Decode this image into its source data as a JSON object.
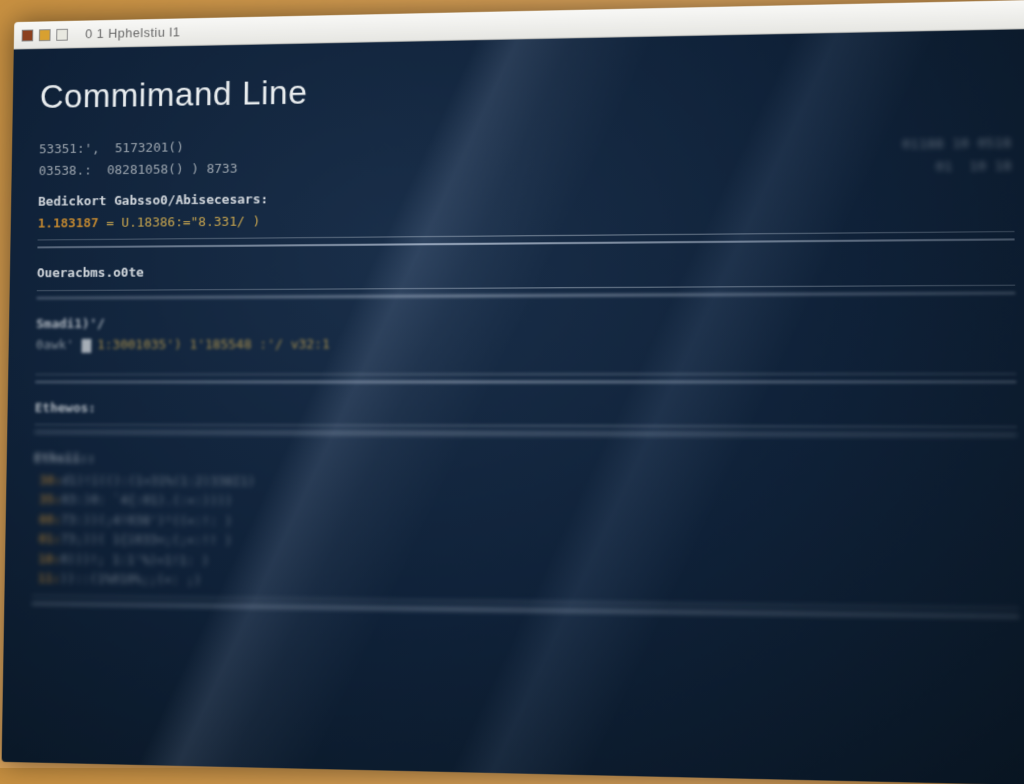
{
  "window": {
    "title": "0 1  Hphelstiu  l1"
  },
  "terminal": {
    "heading": "Commimand Line",
    "right_panel": {
      "row1": "01188 10 0518",
      "row2": "01  10 18"
    },
    "rows": {
      "r01a": "53351:',",
      "r01b": "5173201()",
      "r02a": "03538.:",
      "r02b": "08281058() ) 8733",
      "r03": "Bedickort Gabsso0/Abisecesars:",
      "r04a": "1.183187 ",
      "r04b": "= U.18386:=\"8.331/ )",
      "r05": "Oueracbms.o0te",
      "r06": "Smadi1)'/",
      "r07a": "0awk' ",
      "r07b": "1:3001035') 1'185548 :'/ v32:1",
      "r08": "Ethewos:",
      "r09": "Ethsii::",
      "b1": "d1)!ï(():(1»31%(1:2)338I1)",
      "b2": "03:)0: `4{:01).(:«:))))",
      "b3": "73:))(;4!038')¹((«:!: )",
      "b4": "73;))( 1{ï033<;(;«:!! )",
      "b5": "0)))!; 1:1'%)«1!1: )",
      "b6": "))::(1%010%;;(«: ;)"
    }
  }
}
